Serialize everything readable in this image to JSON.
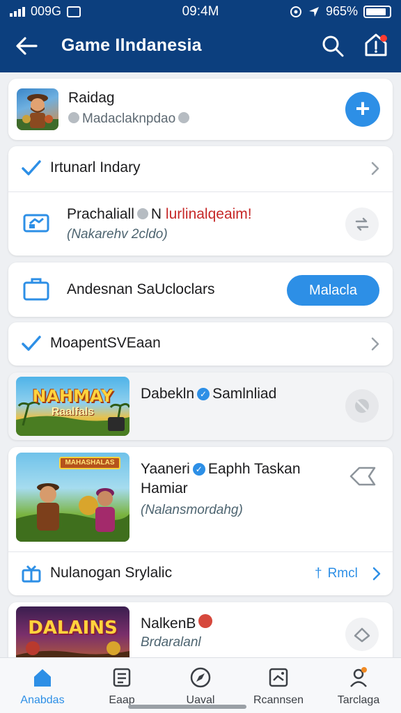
{
  "status_bar": {
    "left_text": "009G",
    "time": "09:4M",
    "battery": "965%"
  },
  "header": {
    "title": "Game Ilndanesia"
  },
  "profile": {
    "name": "Raidag",
    "subtitle": "Madaclaknpdao",
    "add_label": "+"
  },
  "settings_group": {
    "row1_label": "Irtunarl Indary",
    "row2_title_a": "Prachaliall",
    "row2_title_b": "N",
    "row2_title_red": "lurlinalqeaim!",
    "row2_sub": "(Nakarehv 2cldo)"
  },
  "action_row": {
    "label": "Andesnan SaUcloclars",
    "button_label": "Malacla"
  },
  "check_row": {
    "label": "MoapentSVEaan"
  },
  "game_card_1": {
    "thumb_title": "NAHMAY",
    "thumb_sub": "Raalfals",
    "title_a": "Dabekln",
    "title_b": "Samlnliad"
  },
  "game_card_2": {
    "thumb_title": "MAHASHALAS",
    "title_a": "Yaaneri",
    "title_b": "Eaphh Taskan",
    "title_line2": "Hamiar",
    "subtitle": "(Nalansmordahg)",
    "footer_label": "Nulanogan Srylalic",
    "footer_link": "Rmcl",
    "footer_link_prefix": "†"
  },
  "game_card_3": {
    "thumb_title": "DALAINS",
    "title": "NalkenB",
    "subtitle": "Brdaralanl"
  },
  "bottom_nav": {
    "items": [
      {
        "label": "Anabdas",
        "icon": "home-icon",
        "active": true
      },
      {
        "label": "Eaap",
        "icon": "news-icon",
        "active": false
      },
      {
        "label": "Uaval",
        "icon": "compass-icon",
        "active": false
      },
      {
        "label": "Rcannsen",
        "icon": "photo-icon",
        "active": false
      },
      {
        "label": "Tarclaga",
        "icon": "profile-icon",
        "active": false
      }
    ]
  },
  "colors": {
    "header_bg": "#0c3f7e",
    "accent": "#2d8fe6",
    "alert_red": "#c62828",
    "page_bg": "#eef0f3"
  }
}
